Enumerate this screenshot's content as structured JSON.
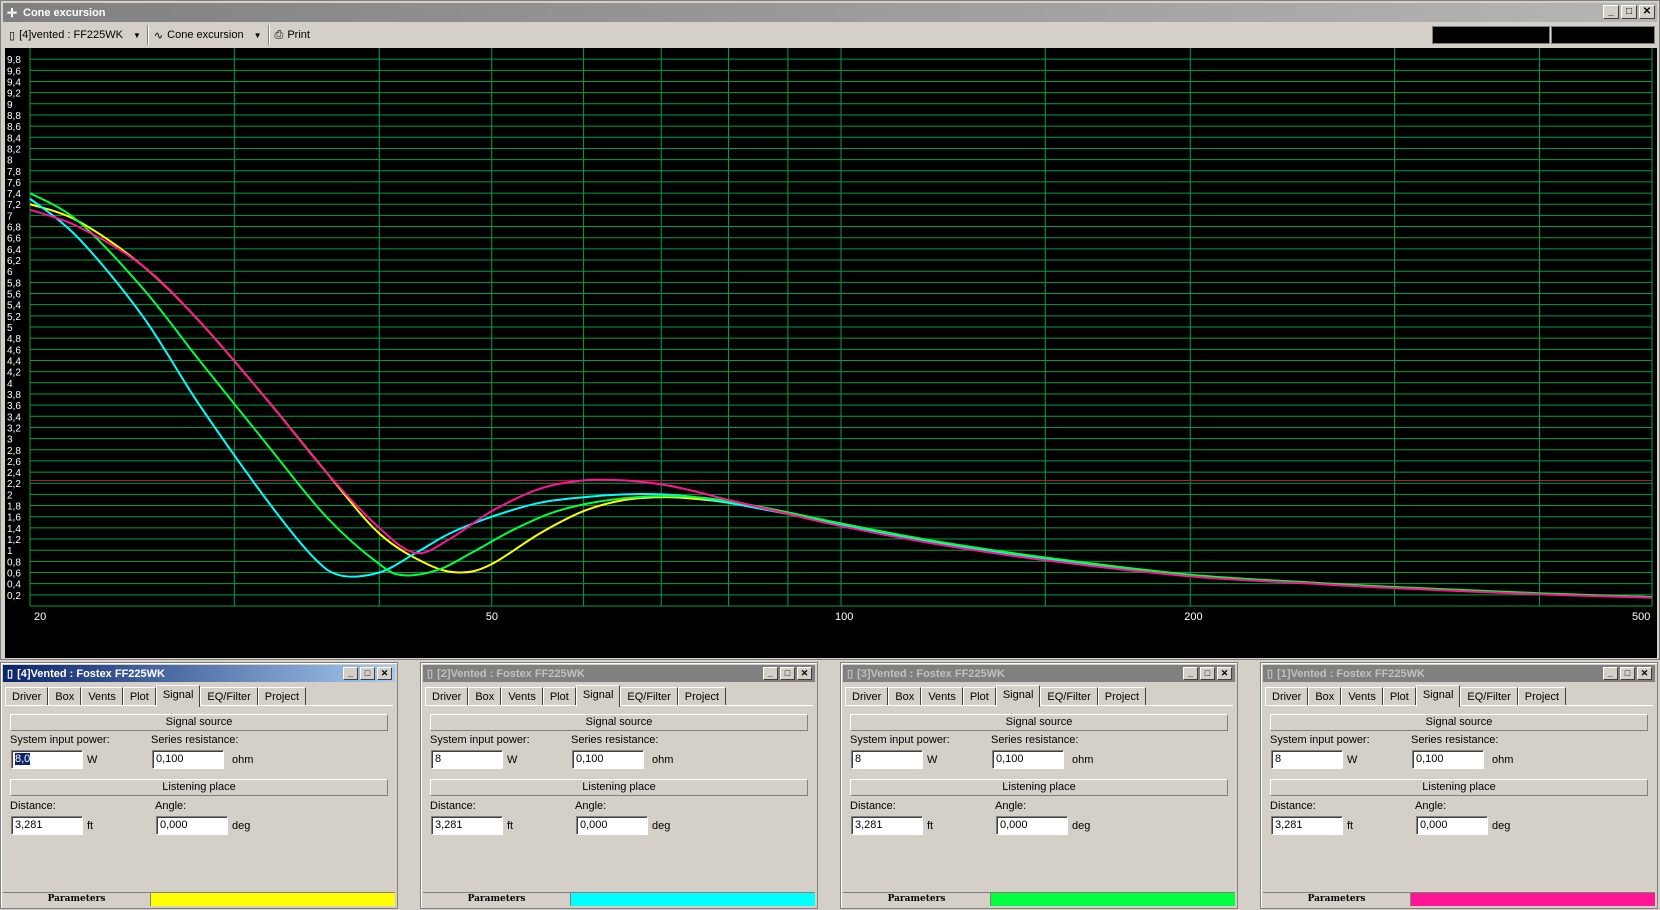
{
  "window": {
    "title": "Cone excursion",
    "icon": "plus-cross-icon",
    "buttons": {
      "minimize": "_",
      "maximize": "□",
      "close": "✕"
    }
  },
  "toolbar": {
    "project_select": "[4]vented : FF225WK",
    "view_select": "Cone excursion",
    "print_label": "Print"
  },
  "chart_data": {
    "type": "line",
    "title": "",
    "xlabel": "",
    "ylabel": "",
    "xscale": "log",
    "xlim": [
      20,
      500
    ],
    "ylim": [
      0,
      10
    ],
    "grid": true,
    "x_tick_labels": [
      "20",
      "50",
      "100",
      "200",
      "500"
    ],
    "y_tick_labels": [
      "0,2",
      "0,4",
      "0,6",
      "0,8",
      "1",
      "1,2",
      "1,4",
      "1,6",
      "1,8",
      "2",
      "2,2",
      "2,4",
      "2,6",
      "2,8",
      "3",
      "3,2",
      "3,4",
      "3,6",
      "3,8",
      "4",
      "4,2",
      "4,4",
      "4,6",
      "4,8",
      "5",
      "5,2",
      "5,4",
      "5,6",
      "5,8",
      "6",
      "6,2",
      "6,4",
      "6,6",
      "6,8",
      "7",
      "7,2",
      "7,4",
      "7,6",
      "7,8",
      "8",
      "8,2",
      "8,4",
      "8,6",
      "8,8",
      "9",
      "9,2",
      "9,4",
      "9,6",
      "9,8"
    ],
    "reference_line": {
      "y": 2.25,
      "color": "#c0143c"
    },
    "series": [
      {
        "color": "#ffff00",
        "x": [
          20,
          22,
          25,
          28,
          32,
          36,
          40,
          44,
          47,
          50,
          55,
          60,
          65,
          70,
          75,
          80,
          90,
          100,
          120,
          150,
          200,
          250,
          300,
          400,
          500
        ],
        "values": [
          7.2,
          6.9,
          6.1,
          5.1,
          3.7,
          2.4,
          1.3,
          0.75,
          0.6,
          0.75,
          1.3,
          1.7,
          1.9,
          1.95,
          1.92,
          1.85,
          1.65,
          1.45,
          1.15,
          0.85,
          0.55,
          0.42,
          0.33,
          0.22,
          0.16
        ]
      },
      {
        "color": "#00ffff",
        "x": [
          20,
          22,
          25,
          28,
          32,
          35,
          37,
          40,
          43,
          46,
          50,
          55,
          60,
          65,
          70,
          75,
          80,
          90,
          100,
          120,
          150,
          200,
          250,
          300,
          400,
          500
        ],
        "values": [
          7.3,
          6.6,
          5.2,
          3.6,
          1.9,
          0.9,
          0.55,
          0.6,
          0.95,
          1.3,
          1.6,
          1.85,
          1.95,
          2.0,
          2.0,
          1.95,
          1.85,
          1.65,
          1.45,
          1.15,
          0.85,
          0.55,
          0.42,
          0.33,
          0.22,
          0.16
        ]
      },
      {
        "color": "#00ff40",
        "x": [
          20,
          22,
          25,
          28,
          32,
          36,
          40,
          42,
          45,
          48,
          52,
          56,
          60,
          65,
          70,
          75,
          80,
          90,
          100,
          120,
          150,
          200,
          250,
          300,
          400,
          500
        ],
        "values": [
          7.4,
          6.9,
          5.7,
          4.4,
          2.9,
          1.6,
          0.75,
          0.55,
          0.65,
          0.95,
          1.35,
          1.65,
          1.82,
          1.93,
          1.97,
          1.95,
          1.88,
          1.68,
          1.48,
          1.17,
          0.87,
          0.56,
          0.43,
          0.34,
          0.23,
          0.16
        ]
      },
      {
        "color": "#ff1493",
        "x": [
          20,
          22,
          25,
          28,
          32,
          36,
          40,
          43,
          46,
          50,
          55,
          60,
          65,
          70,
          75,
          80,
          90,
          100,
          120,
          150,
          200,
          250,
          300,
          400,
          500
        ],
        "values": [
          7.1,
          6.8,
          6.1,
          5.1,
          3.7,
          2.4,
          1.4,
          0.95,
          1.2,
          1.7,
          2.1,
          2.25,
          2.25,
          2.18,
          2.05,
          1.9,
          1.65,
          1.43,
          1.12,
          0.82,
          0.53,
          0.41,
          0.32,
          0.21,
          0.15
        ]
      }
    ]
  },
  "panels": [
    {
      "title": "[4]Vented : Fostex FF225WK",
      "active": true,
      "power": "8,0",
      "resistance": "0,100",
      "distance": "3,281",
      "angle": "0,000",
      "color": "#ffff00"
    },
    {
      "title": "[2]Vented : Fostex FF225WK",
      "active": false,
      "power": "8",
      "resistance": "0,100",
      "distance": "3,281",
      "angle": "0,000",
      "color": "#00ffff"
    },
    {
      "title": "[3]Vented : Fostex FF225WK",
      "active": false,
      "power": "8",
      "resistance": "0,100",
      "distance": "3,281",
      "angle": "0,000",
      "color": "#00ff40"
    },
    {
      "title": "[1]Vented : Fostex FF225WK",
      "active": false,
      "power": "8",
      "resistance": "0,100",
      "distance": "3,281",
      "angle": "0,000",
      "color": "#ff1493"
    }
  ],
  "panel_labels": {
    "tabs": [
      "Driver",
      "Box",
      "Vents",
      "Plot",
      "Signal",
      "EQ/Filter",
      "Project"
    ],
    "selected_tab": "Signal",
    "signal_source": "Signal source",
    "system_input_power": "System input power:",
    "series_resistance": "Series resistance:",
    "unit_w": "W",
    "unit_ohm": "ohm",
    "listening_place": "Listening place",
    "distance": "Distance:",
    "angle": "Angle:",
    "unit_ft": "ft",
    "unit_deg": "deg",
    "status": "Parameters"
  }
}
